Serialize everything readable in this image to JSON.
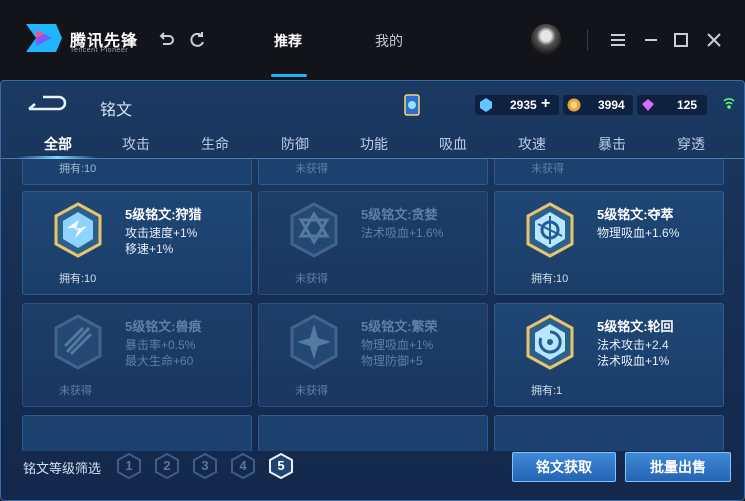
{
  "app": {
    "brand": "腾讯先锋",
    "brand_sub": "Tencent Pioneer"
  },
  "topnav": {
    "tabs": [
      {
        "label": "推荐"
      },
      {
        "label": "我的"
      }
    ]
  },
  "panel": {
    "title": "铭文",
    "currencies": {
      "blue": "2935",
      "gold": "3994",
      "diamond": "125"
    },
    "tabs": [
      "全部",
      "攻击",
      "生命",
      "防御",
      "功能",
      "吸血",
      "攻速",
      "暴击",
      "穿透"
    ],
    "partial_row": [
      "拥有:10",
      "未获得",
      "未获得"
    ],
    "runes": [
      {
        "name": "5级铭文:狩猎",
        "s1": "攻击速度+1%",
        "s2": "移速+1%",
        "own": "拥有:10"
      },
      {
        "name": "5级铭文:贪婪",
        "s1": "法术吸血+1.6%",
        "s2": "",
        "own": "未获得"
      },
      {
        "name": "5级铭文:夺萃",
        "s1": "物理吸血+1.6%",
        "s2": "",
        "own": "拥有:10"
      },
      {
        "name": "5级铭文:兽痕",
        "s1": "暴击率+0.5%",
        "s2": "最大生命+60",
        "own": "未获得"
      },
      {
        "name": "5级铭文:繁荣",
        "s1": "物理吸血+1%",
        "s2": "物理防御+5",
        "own": "未获得"
      },
      {
        "name": "5级铭文:轮回",
        "s1": "法术攻击+2.4",
        "s2": "法术吸血+1%",
        "own": "拥有:1"
      }
    ],
    "filter_label": "铭文等级筛选",
    "levels": [
      "1",
      "2",
      "3",
      "4",
      "5"
    ],
    "buttons": {
      "obtain": "铭文获取",
      "sell": "批量出售"
    }
  }
}
